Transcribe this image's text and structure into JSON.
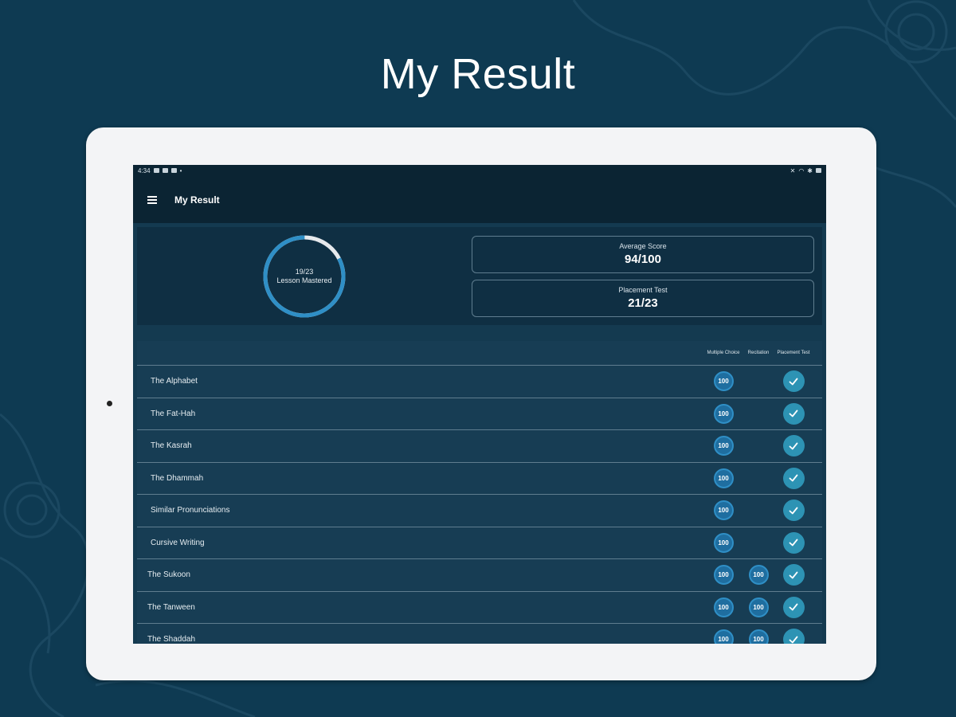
{
  "promo": {
    "title": "My Result"
  },
  "status_bar": {
    "time": "4:34"
  },
  "app_bar": {
    "title": "My Result"
  },
  "summary": {
    "mastered": 19,
    "total": 23,
    "ring_text": "19/23",
    "ring_caption": "Lesson Mastered",
    "average_score_label": "Average Score",
    "average_score_value": "94/100",
    "placement_label": "Placement Test",
    "placement_value": "21/23"
  },
  "table": {
    "columns": [
      "Multiple Choice",
      "Recitation",
      "Placement Test"
    ],
    "rows": [
      {
        "lesson": "The Alphabet",
        "multiple_choice": "100",
        "recitation": "",
        "placement": true
      },
      {
        "lesson": "The Fat-Hah",
        "multiple_choice": "100",
        "recitation": "",
        "placement": true
      },
      {
        "lesson": "The Kasrah",
        "multiple_choice": "100",
        "recitation": "",
        "placement": true
      },
      {
        "lesson": "The Dhammah",
        "multiple_choice": "100",
        "recitation": "",
        "placement": true
      },
      {
        "lesson": "Similar Pronunciations",
        "multiple_choice": "100",
        "recitation": "",
        "placement": true
      },
      {
        "lesson": "Cursive Writing",
        "multiple_choice": "100",
        "recitation": "",
        "placement": true
      },
      {
        "lesson": "The Sukoon",
        "multiple_choice": "100",
        "recitation": "100",
        "placement": true
      },
      {
        "lesson": "The Tanween",
        "multiple_choice": "100",
        "recitation": "100",
        "placement": true
      },
      {
        "lesson": "The Shaddah",
        "multiple_choice": "100",
        "recitation": "100",
        "placement": true
      }
    ]
  },
  "colors": {
    "background": "#0e3a52",
    "accent": "#2f8fc6",
    "check": "#2d93b4",
    "ring_remaining": "#e6e9ec"
  }
}
